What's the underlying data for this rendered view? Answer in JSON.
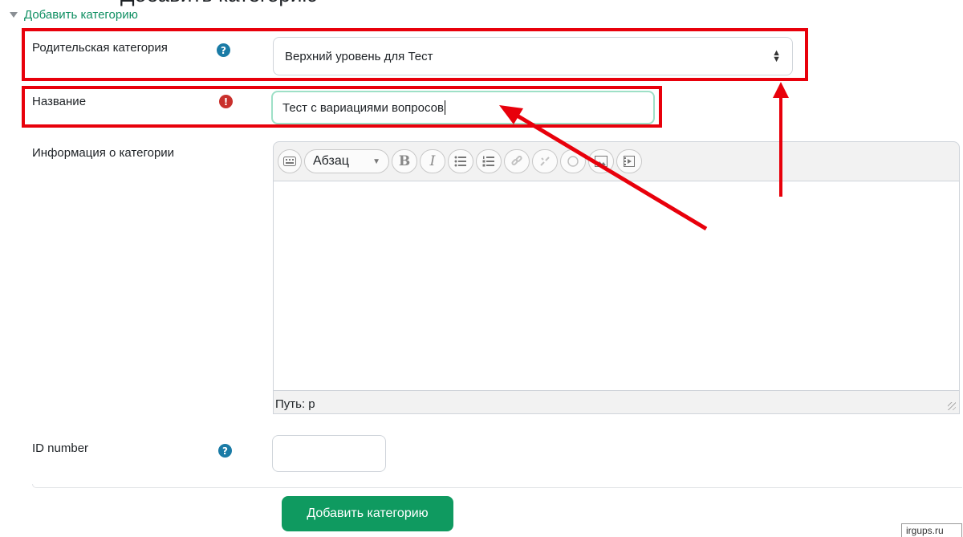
{
  "clipped_heading": "Добавить категорию",
  "section_toggle": {
    "label": "Добавить категорию"
  },
  "parent_category": {
    "label": "Родительская категория",
    "selected_value": "Верхний уровень для Тест"
  },
  "name_field": {
    "label": "Название",
    "value": "Тест с вариациями вопросов"
  },
  "category_info": {
    "label": "Информация о категории",
    "paragraph_format": "Абзац",
    "status_path": "Путь: p"
  },
  "id_number": {
    "label": "ID number",
    "value": ""
  },
  "submit_button": {
    "label": "Добавить категорию"
  },
  "footer_tag": "irgups.ru",
  "colors": {
    "accent_green": "#0f9a60",
    "help_blue": "#1a7ba6",
    "required_red": "#c9302c",
    "annotation_red": "#e8000b"
  }
}
